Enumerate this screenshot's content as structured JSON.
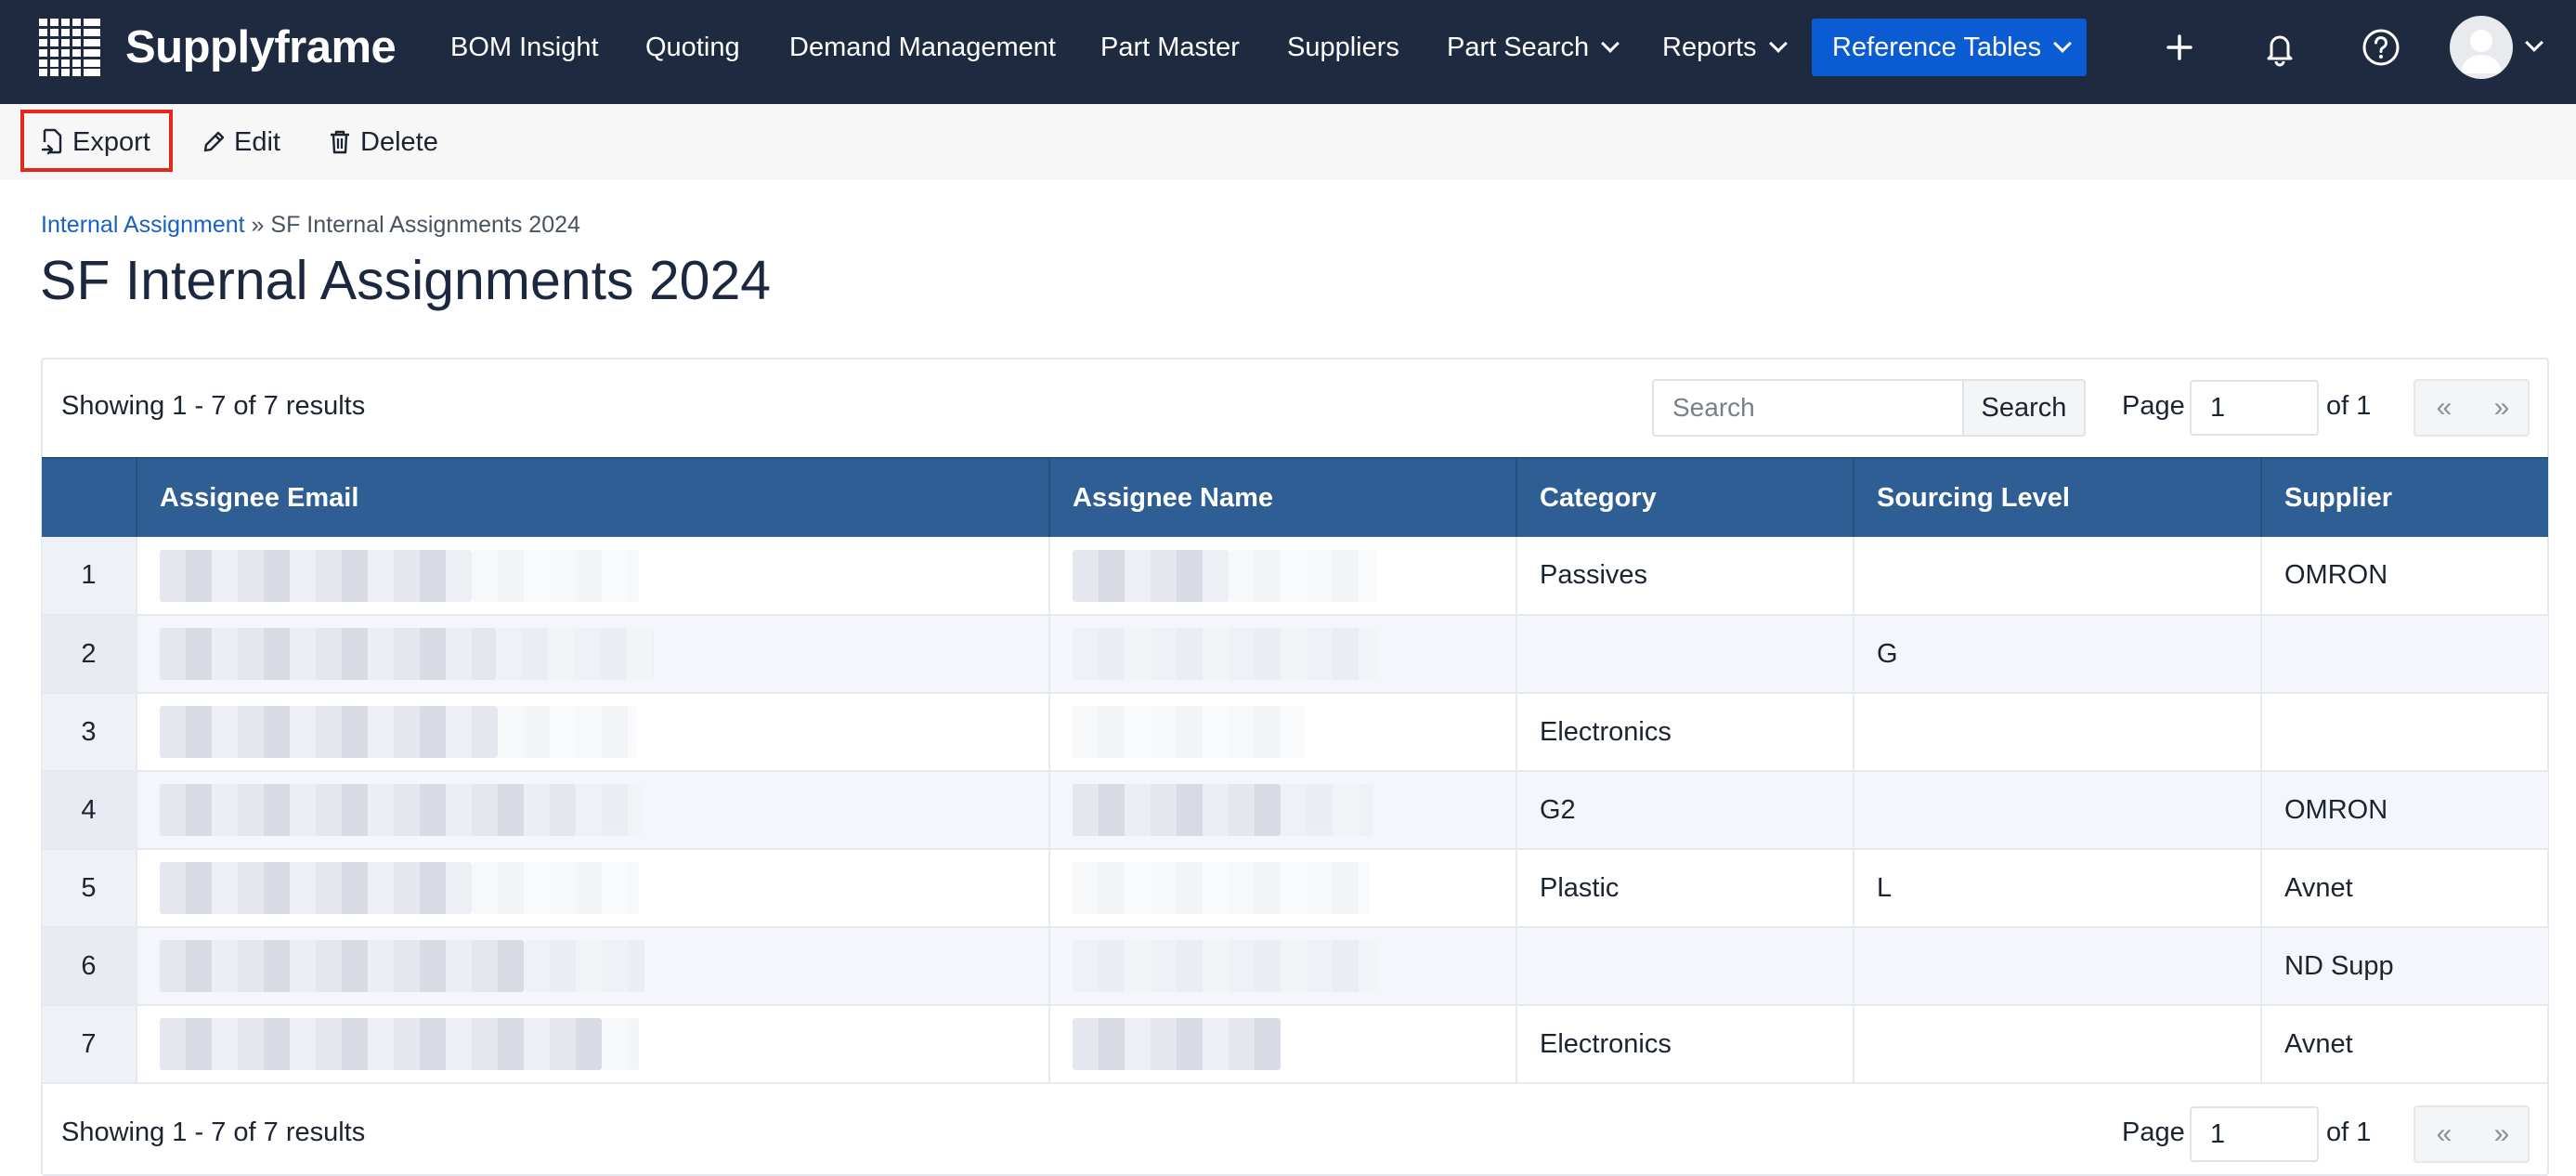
{
  "app": {
    "brand": "Supplyframe",
    "nav": {
      "bom_insight": "BOM Insight",
      "quoting": "Quoting",
      "demand_management": "Demand Management",
      "part_master": "Part Master",
      "suppliers": "Suppliers",
      "part_search": "Part Search",
      "reports": "Reports",
      "reference_tables": "Reference Tables"
    },
    "icons": [
      "grid-logo-icon",
      "plus-icon",
      "bell-icon",
      "help-icon",
      "avatar",
      "chevron-down-icon"
    ],
    "colors": {
      "nav_bg": "#1d2a3f",
      "active_nav": "#0b5bd3",
      "table_header": "#2e5e93",
      "highlight": "#e8271c",
      "link": "#1660c8"
    }
  },
  "actions": {
    "export": "Export",
    "edit": "Edit",
    "delete": "Delete",
    "icons": [
      "export-icon",
      "pencil-icon",
      "trash-icon"
    ]
  },
  "breadcrumb": {
    "parent": "Internal Assignment",
    "separator": "»",
    "current": "SF Internal Assignments 2024"
  },
  "page_title": "SF Internal Assignments 2024",
  "results": {
    "showing_top": "Showing 1 - 7 of 7 results",
    "showing_bottom": "Showing 1 - 7 of 7 results"
  },
  "search": {
    "placeholder": "Search",
    "button": "Search"
  },
  "pagination": {
    "page_label": "Page",
    "page_value": "1",
    "of_label": "of 1",
    "first": "«",
    "last": "»"
  },
  "table": {
    "columns": [
      "",
      "Assignee Email",
      "Assignee Name",
      "Category",
      "Sourcing Level",
      "Supplier"
    ],
    "rows": [
      {
        "num": "1",
        "category": "Passives",
        "sourcing_level": "",
        "supplier": "OMRON"
      },
      {
        "num": "2",
        "category": "",
        "sourcing_level": "G",
        "supplier": ""
      },
      {
        "num": "3",
        "category": "Electronics",
        "sourcing_level": "",
        "supplier": ""
      },
      {
        "num": "4",
        "category": "G2",
        "sourcing_level": "",
        "supplier": "OMRON"
      },
      {
        "num": "5",
        "category": "Plastic",
        "sourcing_level": "L",
        "supplier": "Avnet"
      },
      {
        "num": "6",
        "category": "",
        "sourcing_level": "",
        "supplier": "ND Supp"
      },
      {
        "num": "7",
        "category": "Electronics",
        "sourcing_level": "",
        "supplier": "Avnet"
      }
    ]
  }
}
